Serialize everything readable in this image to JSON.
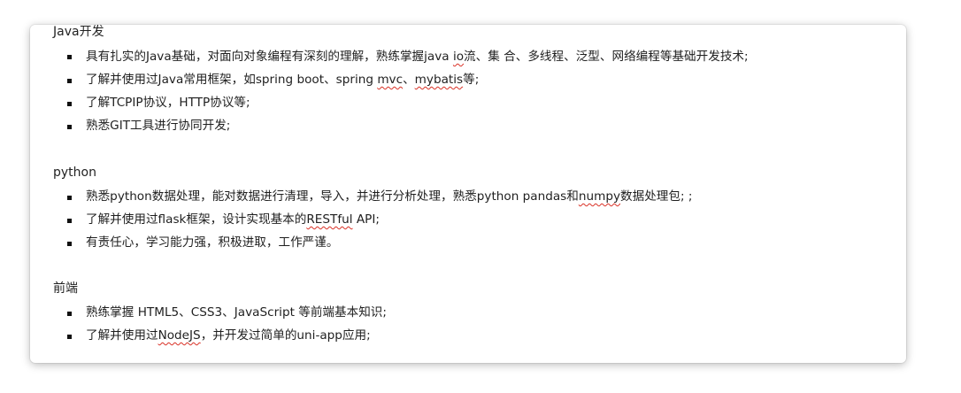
{
  "sections": [
    {
      "heading": "Java开发",
      "items": [
        {
          "segments": [
            {
              "text": "具有扎实的Java基础，对面向对象编程有深刻的理解，熟练掌握java ",
              "spell": false
            },
            {
              "text": "io",
              "spell": true
            },
            {
              "text": "流、集 合、多线程、泛型、网络编程等基础开发技术;",
              "spell": false
            }
          ]
        },
        {
          "segments": [
            {
              "text": "了解并使用过Java常用框架，如spring boot、spring ",
              "spell": false
            },
            {
              "text": "mvc",
              "spell": true
            },
            {
              "text": "、",
              "spell": false
            },
            {
              "text": "mybatis",
              "spell": true
            },
            {
              "text": "等;",
              "spell": false
            }
          ]
        },
        {
          "segments": [
            {
              "text": "了解TCPIP协议，HTTP协议等;",
              "spell": false
            }
          ]
        },
        {
          "segments": [
            {
              "text": "熟悉GIT工具进行协同开发;",
              "spell": false
            }
          ]
        }
      ]
    },
    {
      "heading": "python",
      "items": [
        {
          "segments": [
            {
              "text": "熟悉python数据处理，能对数据进行清理，导入，并进行分析处理，熟悉python pandas和",
              "spell": false
            },
            {
              "text": "numpy",
              "spell": true
            },
            {
              "text": "数据处理包; ;",
              "spell": false
            }
          ]
        },
        {
          "segments": [
            {
              "text": "了解并使用过flask框架，设计实现基本的",
              "spell": false
            },
            {
              "text": "RESTful",
              "spell": true
            },
            {
              "text": " API;",
              "spell": false
            }
          ]
        },
        {
          "segments": [
            {
              "text": "有责任心，学习能力强，积极进取，工作严谨。",
              "spell": false
            }
          ]
        }
      ]
    },
    {
      "heading": "前端",
      "items": [
        {
          "segments": [
            {
              "text": "熟练掌握 HTML5、CSS3、JavaScript 等前端基本知识;",
              "spell": false
            }
          ]
        },
        {
          "segments": [
            {
              "text": "了解并使用过",
              "spell": false
            },
            {
              "text": "NodeJS",
              "spell": true
            },
            {
              "text": "，并开发过简单的uni-app应用;",
              "spell": false
            }
          ]
        }
      ]
    }
  ]
}
